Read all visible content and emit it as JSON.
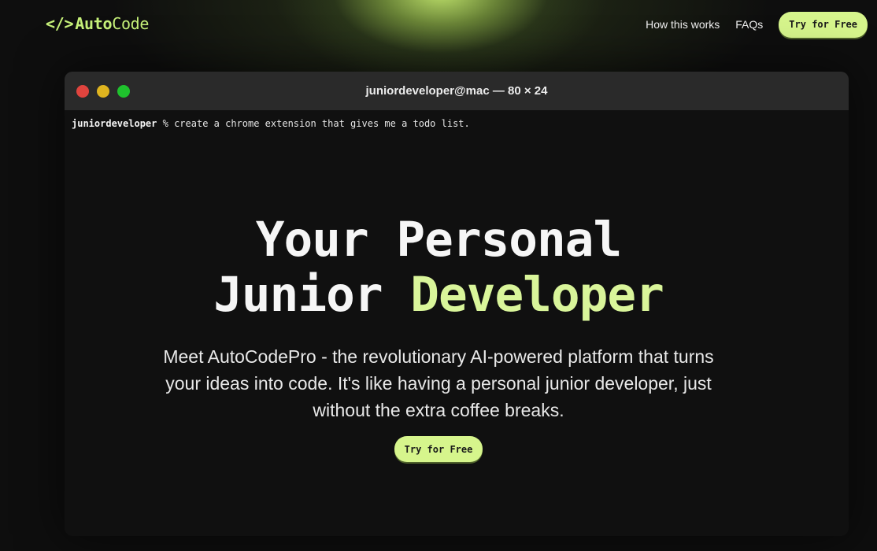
{
  "header": {
    "logo": {
      "icon_text": "</>",
      "part1": "Auto",
      "part2": "Code"
    },
    "nav": {
      "how_it_works": "How this works",
      "faqs": "FAQs",
      "cta": "Try for Free"
    }
  },
  "terminal": {
    "title": "juniordeveloper@mac — 80 × 24",
    "prompt_user": "juniordeveloper",
    "prompt_symbol": "%",
    "command": "create a chrome extension that gives me a todo list."
  },
  "hero": {
    "title_line1": "Your Personal",
    "title_line2_plain": "Junior",
    "title_line2_accent": "Developer",
    "description": "Meet AutoCodePro - the revolutionary AI-powered platform that turns your ideas into code. It's like having a personal junior developer, just without the extra coffee breaks.",
    "cta": "Try for Free"
  },
  "colors": {
    "accent": "#d6f58c",
    "background": "#0e0e0e",
    "terminal_bar": "#2a2a2a"
  }
}
